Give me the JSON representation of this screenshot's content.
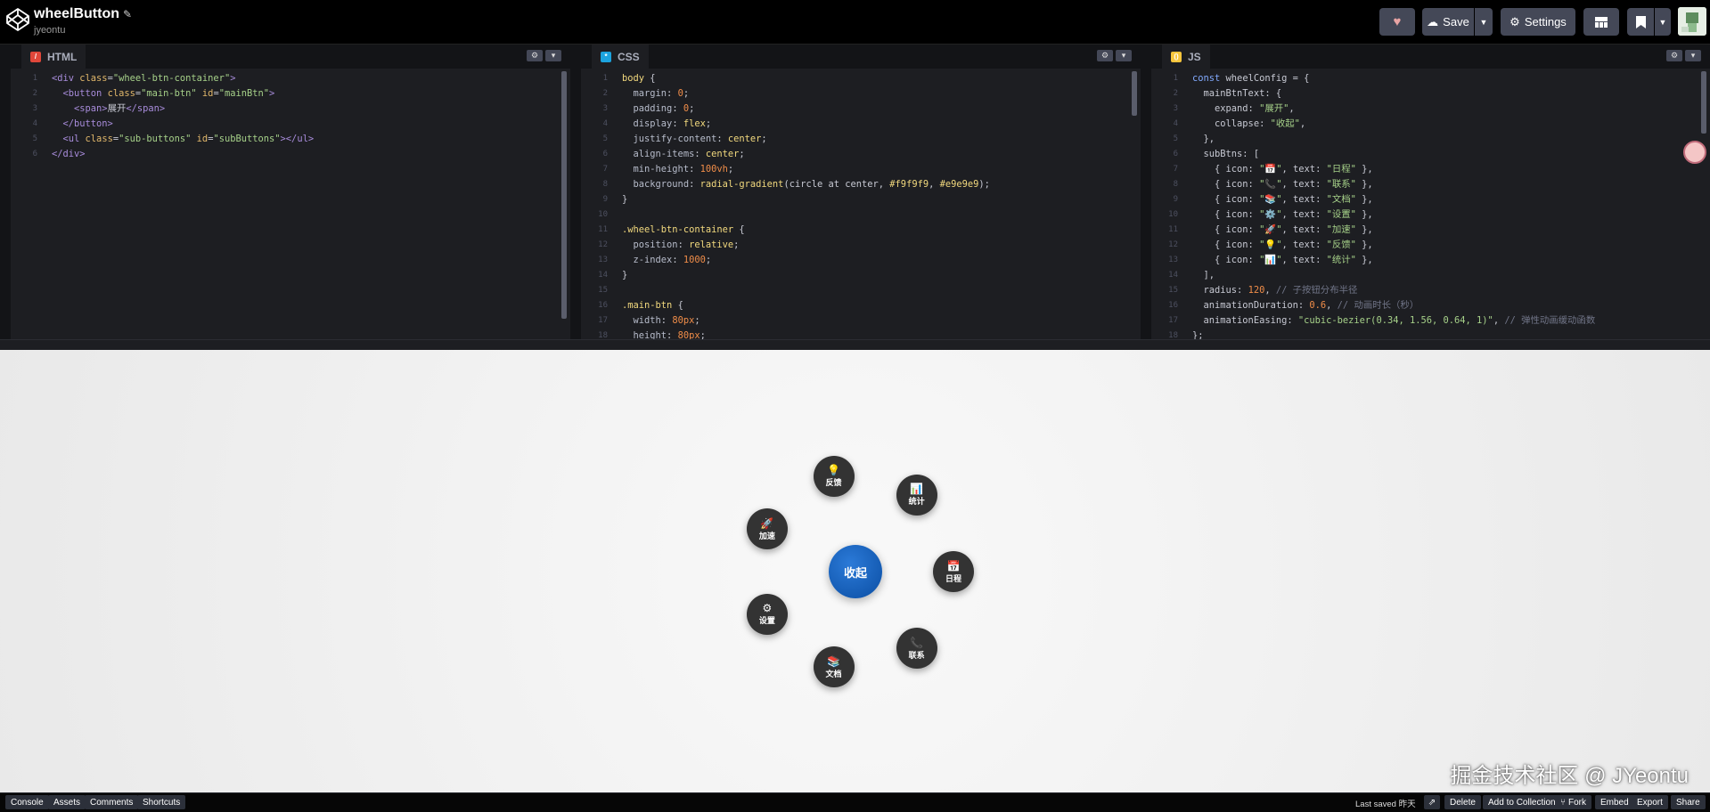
{
  "header": {
    "title": "wheelButton",
    "author": "jyeontu",
    "save_label": "Save",
    "settings_label": "Settings"
  },
  "panes": [
    {
      "title": "HTML",
      "badge_color": "#e0473a",
      "badge_glyph": "/",
      "lines": [
        [
          [
            "tag",
            "<div "
          ],
          [
            "attr",
            "class"
          ],
          [
            "",
            "="
          ],
          [
            "str",
            "\"wheel-btn-container\""
          ],
          [
            "tag",
            ">"
          ]
        ],
        [
          [
            "",
            "  "
          ],
          [
            "tag",
            "<button "
          ],
          [
            "attr",
            "class"
          ],
          [
            "",
            "="
          ],
          [
            "str",
            "\"main-btn\""
          ],
          [
            "",
            ""
          ],
          [
            "attr",
            " id"
          ],
          [
            "",
            "="
          ],
          [
            "str",
            "\"mainBtn\""
          ],
          [
            "tag",
            ">"
          ]
        ],
        [
          [
            "",
            "    "
          ],
          [
            "tag",
            "<span>"
          ],
          [
            "",
            "展开"
          ],
          [
            "tag",
            "</span>"
          ]
        ],
        [
          [
            "",
            "  "
          ],
          [
            "tag",
            "</button>"
          ]
        ],
        [
          [
            "",
            "  "
          ],
          [
            "tag",
            "<ul "
          ],
          [
            "attr",
            "class"
          ],
          [
            "",
            "="
          ],
          [
            "str",
            "\"sub-buttons\""
          ],
          [
            "attr",
            " id"
          ],
          [
            "",
            "="
          ],
          [
            "str",
            "\"subButtons\""
          ],
          [
            "tag",
            "></ul>"
          ]
        ],
        [
          [
            "tag",
            "</div>"
          ]
        ]
      ]
    },
    {
      "title": "CSS",
      "badge_color": "#1ca3de",
      "badge_glyph": "*",
      "lines": [
        [
          [
            "sel",
            "body "
          ],
          [
            "",
            "{"
          ]
        ],
        [
          [
            "prop",
            "  margin"
          ],
          [
            "",
            ": "
          ],
          [
            "num",
            "0"
          ],
          [
            "",
            ";"
          ]
        ],
        [
          [
            "prop",
            "  padding"
          ],
          [
            "",
            ": "
          ],
          [
            "num",
            "0"
          ],
          [
            "",
            ";"
          ]
        ],
        [
          [
            "prop",
            "  display"
          ],
          [
            "",
            ": "
          ],
          [
            "sel",
            "flex"
          ],
          [
            "",
            ";"
          ]
        ],
        [
          [
            "prop",
            "  justify-content"
          ],
          [
            "",
            ": "
          ],
          [
            "sel",
            "center"
          ],
          [
            "",
            ";"
          ]
        ],
        [
          [
            "prop",
            "  align-items"
          ],
          [
            "",
            ": "
          ],
          [
            "sel",
            "center"
          ],
          [
            "",
            ";"
          ]
        ],
        [
          [
            "prop",
            "  min-height"
          ],
          [
            "",
            ": "
          ],
          [
            "num",
            "100vh"
          ],
          [
            "",
            ";"
          ]
        ],
        [
          [
            "prop",
            "  background"
          ],
          [
            "",
            ": "
          ],
          [
            "sel",
            "radial-gradient"
          ],
          [
            "",
            "(circle at center, "
          ],
          [
            "sel",
            "#f9f9f9"
          ],
          [
            "",
            ", "
          ],
          [
            "sel",
            "#e9e9e9"
          ],
          [
            "",
            ");"
          ]
        ],
        [
          [
            "",
            "}"
          ]
        ],
        [
          [
            "",
            ""
          ]
        ],
        [
          [
            "sel",
            ".wheel-btn-container "
          ],
          [
            "",
            "{"
          ]
        ],
        [
          [
            "prop",
            "  position"
          ],
          [
            "",
            ": "
          ],
          [
            "sel",
            "relative"
          ],
          [
            "",
            ";"
          ]
        ],
        [
          [
            "prop",
            "  z-index"
          ],
          [
            "",
            ": "
          ],
          [
            "num",
            "1000"
          ],
          [
            "",
            ";"
          ]
        ],
        [
          [
            "",
            "}"
          ]
        ],
        [
          [
            "",
            ""
          ]
        ],
        [
          [
            "sel",
            ".main-btn "
          ],
          [
            "",
            "{"
          ]
        ],
        [
          [
            "prop",
            "  width"
          ],
          [
            "",
            ": "
          ],
          [
            "num",
            "80px"
          ],
          [
            "",
            ";"
          ]
        ],
        [
          [
            "prop",
            "  height"
          ],
          [
            "",
            ": "
          ],
          [
            "num",
            "80px"
          ],
          [
            "",
            ";"
          ]
        ]
      ]
    },
    {
      "title": "JS",
      "badge_color": "#f7c53c",
      "badge_glyph": "()",
      "lines": [
        [
          [
            "kw",
            "const "
          ],
          [
            "",
            "wheelConfig = {"
          ]
        ],
        [
          [
            "",
            "  mainBtnText: {"
          ]
        ],
        [
          [
            "",
            "    expand: "
          ],
          [
            "str",
            "\"展开\""
          ],
          [
            "",
            ","
          ]
        ],
        [
          [
            "",
            "    collapse: "
          ],
          [
            "str",
            "\"收起\""
          ],
          [
            "",
            ","
          ]
        ],
        [
          [
            "",
            "  },"
          ]
        ],
        [
          [
            "",
            "  subBtns: ["
          ]
        ],
        [
          [
            "",
            "    { icon: "
          ],
          [
            "str",
            "\"📅\""
          ],
          [
            "",
            ", text: "
          ],
          [
            "str",
            "\"日程\""
          ],
          [
            "",
            " },"
          ]
        ],
        [
          [
            "",
            "    { icon: "
          ],
          [
            "str",
            "\"📞\""
          ],
          [
            "",
            ", text: "
          ],
          [
            "str",
            "\"联系\""
          ],
          [
            "",
            " },"
          ]
        ],
        [
          [
            "",
            "    { icon: "
          ],
          [
            "str",
            "\"📚\""
          ],
          [
            "",
            ", text: "
          ],
          [
            "str",
            "\"文档\""
          ],
          [
            "",
            " },"
          ]
        ],
        [
          [
            "",
            "    { icon: "
          ],
          [
            "str",
            "\"⚙️\""
          ],
          [
            "",
            ", text: "
          ],
          [
            "str",
            "\"设置\""
          ],
          [
            "",
            " },"
          ]
        ],
        [
          [
            "",
            "    { icon: "
          ],
          [
            "str",
            "\"🚀\""
          ],
          [
            "",
            ", text: "
          ],
          [
            "str",
            "\"加速\""
          ],
          [
            "",
            " },"
          ]
        ],
        [
          [
            "",
            "    { icon: "
          ],
          [
            "str",
            "\"💡\""
          ],
          [
            "",
            ", text: "
          ],
          [
            "str",
            "\"反馈\""
          ],
          [
            "",
            " },"
          ]
        ],
        [
          [
            "",
            "    { icon: "
          ],
          [
            "str",
            "\"📊\""
          ],
          [
            "",
            ", text: "
          ],
          [
            "str",
            "\"统计\""
          ],
          [
            "",
            " },"
          ]
        ],
        [
          [
            "",
            "  ],"
          ]
        ],
        [
          [
            "",
            "  radius: "
          ],
          [
            "num",
            "120"
          ],
          [
            "",
            ", "
          ],
          [
            "cmt",
            "// 子按钮分布半径"
          ]
        ],
        [
          [
            "",
            "  animationDuration: "
          ],
          [
            "num",
            "0.6"
          ],
          [
            "",
            ", "
          ],
          [
            "cmt",
            "// 动画时长（秒）"
          ]
        ],
        [
          [
            "",
            "  animationEasing: "
          ],
          [
            "str",
            "\"cubic-bezier(0.34, 1.56, 0.64, 1)\""
          ],
          [
            "",
            ", "
          ],
          [
            "cmt",
            "// 弹性动画缓动函数"
          ]
        ],
        [
          [
            "",
            "};"
          ]
        ]
      ]
    }
  ],
  "preview": {
    "main_label": "收起",
    "sub_buttons": [
      {
        "icon": "📅",
        "icon_name": "calendar-icon",
        "text": "日程"
      },
      {
        "icon": "📞",
        "icon_name": "phone-icon",
        "text": "联系"
      },
      {
        "icon": "📚",
        "icon_name": "books-icon",
        "text": "文档"
      },
      {
        "icon": "⚙",
        "icon_name": "gear-icon",
        "text": "设置"
      },
      {
        "icon": "🚀",
        "icon_name": "rocket-icon",
        "text": "加速"
      },
      {
        "icon": "💡",
        "icon_name": "lightbulb-icon",
        "text": "反馈"
      },
      {
        "icon": "📊",
        "icon_name": "chart-icon",
        "text": "统计"
      }
    ],
    "watermark": "掘金技术社区 @ JYeontu"
  },
  "footer": {
    "left_buttons": [
      "Console",
      "Assets",
      "Comments",
      "Shortcuts"
    ],
    "saved_text": "Last saved 昨天",
    "right_buttons": [
      "Delete",
      "Add to Collection",
      "Fork",
      "Embed",
      "Export",
      "Share"
    ]
  }
}
